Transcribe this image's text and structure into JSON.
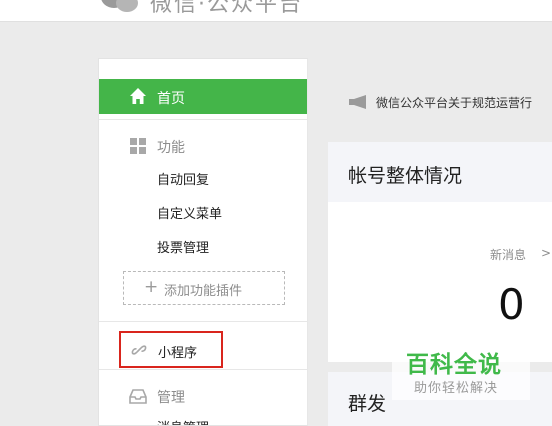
{
  "header": {
    "title": "微信·公众平台",
    "logo_icon": "wechat-logo-icon"
  },
  "sidebar": {
    "home": {
      "label": "首页",
      "icon": "home-icon"
    },
    "features": {
      "label": "功能",
      "icon": "grid-icon",
      "items": [
        "自动回复",
        "自定义菜单",
        "投票管理"
      ],
      "add_plugin": "添加功能插件"
    },
    "mini_program": {
      "label": "小程序",
      "icon": "link-icon"
    },
    "manage": {
      "label": "管理",
      "icon": "inbox-icon",
      "items": [
        "消息管理"
      ]
    }
  },
  "main": {
    "notice": {
      "icon": "megaphone-icon",
      "text": "微信公众平台关于规范运营行"
    },
    "account_overview": {
      "title": "帐号整体情况"
    },
    "stats": {
      "new_messages_label": "新消息",
      "new_messages_count": "0",
      "chevron": ">"
    },
    "mass_send": {
      "title": "群发"
    }
  },
  "watermark": {
    "title": "百科全说",
    "subtitle": "助你轻松解决"
  },
  "colors": {
    "accent_green": "#44b549",
    "highlight_red": "#d9251d"
  }
}
